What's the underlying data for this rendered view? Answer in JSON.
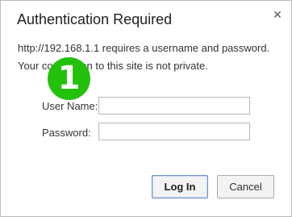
{
  "dialog": {
    "title": "Authentication Required",
    "close_glyph": "✕",
    "message_line1": "http://192.168.1.1 requires a username and password.",
    "message_line2": "Your connection to this site is not private."
  },
  "form": {
    "username_label": "User Name:",
    "username_value": "",
    "password_label": "Password:",
    "password_value": ""
  },
  "buttons": {
    "login_label": "Log In",
    "cancel_label": "Cancel"
  },
  "step_badge": {
    "number": "1",
    "color": "#22c20b"
  },
  "icons": {
    "close": "close-icon"
  }
}
